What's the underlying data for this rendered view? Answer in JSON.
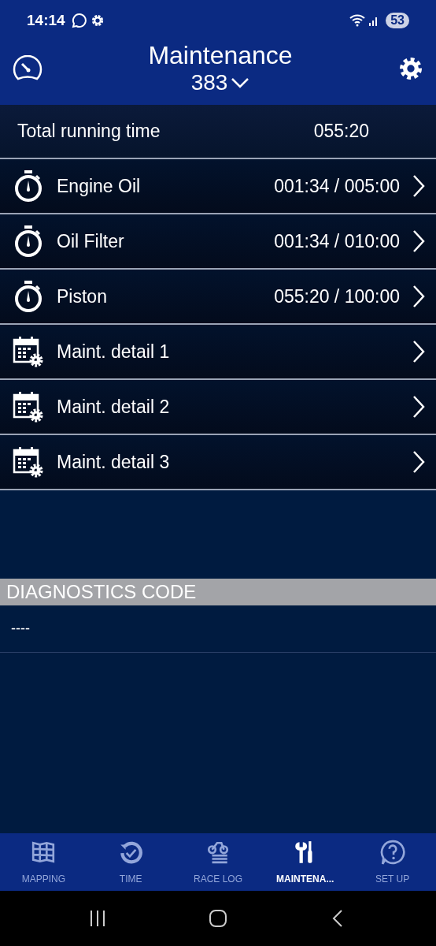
{
  "status_bar": {
    "time": "14:14",
    "battery": "53"
  },
  "header": {
    "title": "Maintenance",
    "subtitle": "383"
  },
  "total": {
    "label": "Total running time",
    "value": "055:20"
  },
  "items": [
    {
      "kind": "timer",
      "label": "Engine Oil",
      "value": "001:34 / 005:00"
    },
    {
      "kind": "timer",
      "label": "Oil Filter",
      "value": "001:34 / 010:00"
    },
    {
      "kind": "timer",
      "label": "Piston",
      "value": "055:20 / 100:00"
    },
    {
      "kind": "schedule",
      "label": "Maint. detail 1"
    },
    {
      "kind": "schedule",
      "label": "Maint. detail 2"
    },
    {
      "kind": "schedule",
      "label": "Maint. detail 3"
    }
  ],
  "diagnostics": {
    "title": "DIAGNOSTICS CODE",
    "code": "----"
  },
  "tabs": [
    {
      "kind": "map",
      "label": "MAPPING",
      "selected": false
    },
    {
      "kind": "time",
      "label": "TIME",
      "selected": false
    },
    {
      "kind": "log",
      "label": "RACE LOG",
      "selected": false
    },
    {
      "kind": "tools",
      "label": "MAINTENA...",
      "selected": true
    },
    {
      "kind": "help",
      "label": "SET UP",
      "selected": false
    }
  ]
}
